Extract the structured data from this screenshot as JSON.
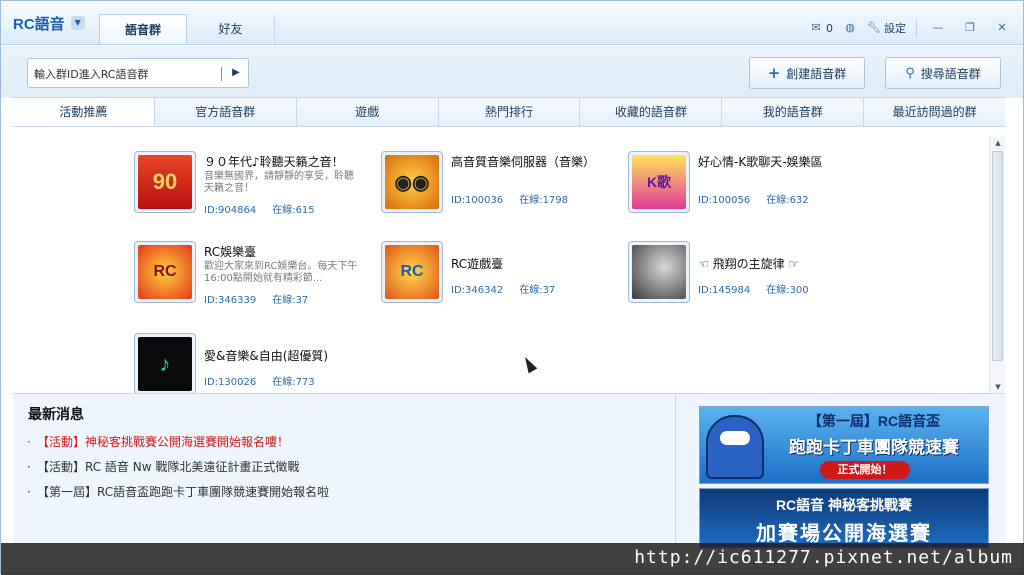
{
  "app": {
    "logo": "RC語音",
    "top_tabs": [
      "語音群",
      "好友"
    ],
    "mail_count": "0",
    "settings_label": "設定"
  },
  "search": {
    "placeholder": "輸入群ID進入RC語音群",
    "create_label": "創建語音群",
    "find_label": "搜尋語音群"
  },
  "category_tabs": [
    "活動推薦",
    "官方語音群",
    "遊戲",
    "熱門排行",
    "收藏的語音群",
    "我的語音群",
    "最近訪問過的群"
  ],
  "rooms": [
    {
      "name": "９０年代♪聆聽天籟之音！",
      "desc": "音樂無國界，請靜靜的享受，聆聽天籟之音！",
      "id": "ID:904864",
      "online": "在線:615",
      "icon": "90s-icon"
    },
    {
      "name": "高音質音樂伺服器（音樂）",
      "desc": "",
      "id": "ID:100036",
      "online": "在線:1798",
      "icon": "speakers-icon"
    },
    {
      "name": "好心情-K歌聊天-娛樂區",
      "desc": "",
      "id": "ID:100056",
      "online": "在線:632",
      "icon": "karaoke-icon"
    },
    {
      "name": "RC娛樂臺",
      "desc": "歡迎大家來到RC娛樂台。每天下午16:00點開始就有精彩節...",
      "id": "ID:346339",
      "online": "在線:37",
      "icon": "rc-entertain-icon"
    },
    {
      "name": "RC遊戲臺",
      "desc": "",
      "id": "ID:346342",
      "online": "在線:37",
      "icon": "rc-game-icon"
    },
    {
      "name": "☜ 飛翔の主旋律 ☞",
      "desc": "",
      "id": "ID:145984",
      "online": "在線:300",
      "icon": "sky-icon"
    },
    {
      "name": "愛&音樂&自由(超優質)",
      "desc": "",
      "id": "ID:130026",
      "online": "在線:773",
      "icon": "music-note-icon"
    }
  ],
  "news": {
    "title": "最新消息",
    "items": [
      "【活動】神秘客挑戰賽公開海選賽開始報名嘍！",
      "【活動】RC 語音 Nw 戰隊北美遠征計畫正式徵戰",
      "【第一屆】RC語音盃跑跑卡丁車團隊競速賽開始報名啦"
    ]
  },
  "banners": {
    "b1_line1": "【第一屆】RC語音盃",
    "b1_line2": "跑跑卡丁車團隊競速賽",
    "b1_pill": "正式開始！",
    "b2_line1": "RC語音 神秘客挑戰賽",
    "b2_line2": "加賽場公開海選賽"
  },
  "watermark": "http://ic611277.pixnet.net/album",
  "colors": {
    "accent": "#1b5fae",
    "hot_news": "#d31d1d",
    "link": "#2f6aa8"
  }
}
